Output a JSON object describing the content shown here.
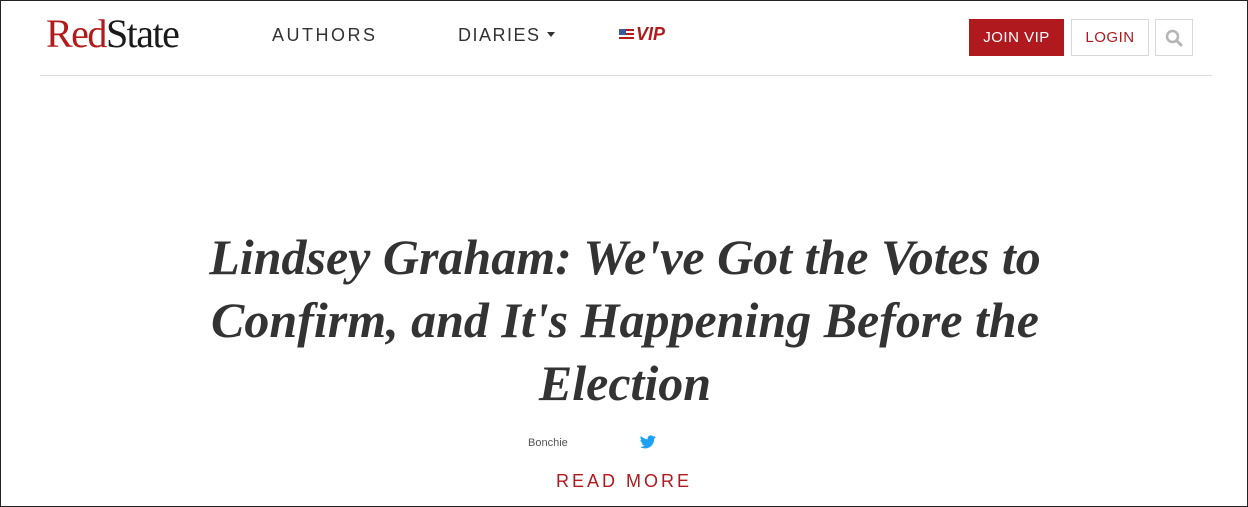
{
  "header": {
    "logo": {
      "part1": "Red",
      "part2": "State"
    },
    "nav": {
      "authors": "AUTHORS",
      "diaries": "DIARIES",
      "vip": "VIP"
    },
    "join_vip": "JOIN VIP",
    "login": "LOGIN",
    "search_icon": "search-icon"
  },
  "article": {
    "title": "Lindsey Graham: We've Got the Votes to Confirm, and It's Happening Before the Election",
    "author": "Bonchie",
    "twitter_icon": "twitter-icon",
    "read_more": "READ MORE"
  },
  "colors": {
    "brand_red": "#b0191e",
    "text_dark": "#333333",
    "border": "#dcdcdc",
    "twitter_blue": "#1da1f2"
  }
}
